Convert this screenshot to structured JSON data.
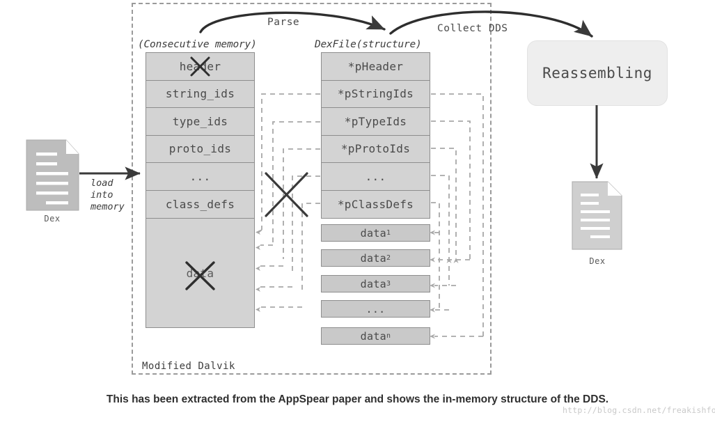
{
  "diagram": {
    "container_label": "Modified Dalvik",
    "memory": {
      "caption": "(Consecutive memory)",
      "rows": [
        "header",
        "string_ids",
        "type_ids",
        "proto_ids",
        "...",
        "class_defs"
      ],
      "data_region_label": "data",
      "struck_out_rows": [
        "header",
        "data"
      ]
    },
    "dexfile": {
      "caption": "DexFile(structure)",
      "rows": [
        "*pHeader",
        "*pStringIds",
        "*pTypeIds",
        "*pProtoIds",
        "...",
        "*pClassDefs"
      ]
    },
    "data_blocks": [
      {
        "base": "data",
        "sub": "1"
      },
      {
        "base": "data",
        "sub": "2"
      },
      {
        "base": "data",
        "sub": "3"
      },
      {
        "base": "...",
        "sub": ""
      },
      {
        "base": "data",
        "sub": "n"
      }
    ],
    "reassembling_label": "Reassembling",
    "arcs": {
      "parse": "Parse",
      "collect": "Collect DDS"
    },
    "load_label": "load\ninto\nmemory",
    "input_file_label": "Dex",
    "output_file_label": "Dex"
  },
  "caption": {
    "text": "This has been extracted from the AppSpear paper and shows the in-memory structure of the DDS.",
    "watermark": "http://blog.csdn.net/freakishfox"
  },
  "colors": {
    "block_fill": "#d3d3d3",
    "data_block_fill": "#c9c9c9",
    "border": "#8d8d8d",
    "dashed": "#9a9a9a",
    "arrow": "#3a3a3a",
    "reassembling_fill": "#eeeeee"
  }
}
